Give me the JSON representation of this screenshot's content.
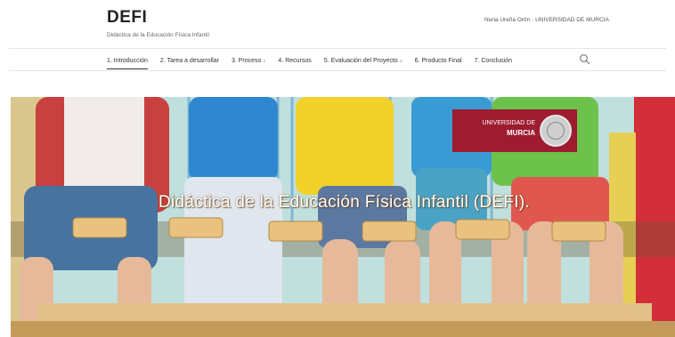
{
  "site": {
    "title": "DEFI",
    "subtitle": "Didáctica de la Educación Física Infantil"
  },
  "author": "Nuria Ureña Ortín · UNIVERSIDAD DE MURCIA",
  "nav": {
    "items": [
      {
        "label": "1. Introducción",
        "active": true,
        "has_dropdown": false
      },
      {
        "label": "2. Tarea a desarrollar",
        "active": false,
        "has_dropdown": false
      },
      {
        "label": "3. Proceso",
        "active": false,
        "has_dropdown": true
      },
      {
        "label": "4. Recursos",
        "active": false,
        "has_dropdown": false
      },
      {
        "label": "5. Evaluación del Proyecto",
        "active": false,
        "has_dropdown": true
      },
      {
        "label": "6. Producto Final",
        "active": false,
        "has_dropdown": false
      },
      {
        "label": "7. Conclusión",
        "active": false,
        "has_dropdown": false
      }
    ],
    "dropdown_caret": "↓",
    "search_icon": "search-icon"
  },
  "hero": {
    "title": "Didáctica de la Educación Física Infantil (DEFI).",
    "logo": {
      "line1": "UNIVERSIDAD DE",
      "line2": "MURCIA",
      "color": "#9e1c30"
    }
  }
}
